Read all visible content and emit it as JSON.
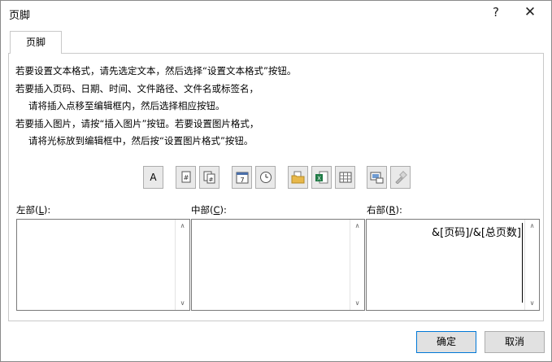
{
  "window": {
    "title": "页脚",
    "help": "?",
    "close": "✕"
  },
  "tab": {
    "label": "页脚"
  },
  "instructions": [
    "若要设置文本格式，请先选定文本，然后选择“设置文本格式”按钮。",
    "若要插入页码、日期、时间、文件路径、文件名或标签名，",
    "请将插入点移至编辑框内，然后选择相应按钮。",
    "若要插入图片，请按“插入图片”按钮。若要设置图片格式，",
    "请将光标放到编辑框中，然后按“设置图片格式”按钮。"
  ],
  "toolbar": {
    "format_text": "A",
    "page_number": "#",
    "total_pages": "#",
    "date": "7",
    "time": "◷"
  },
  "sections": {
    "left": {
      "label_pre": "左部(",
      "key": "L",
      "label_post": "):",
      "value": ""
    },
    "center": {
      "label_pre": "中部(",
      "key": "C",
      "label_post": "):",
      "value": ""
    },
    "right": {
      "label_pre": "右部(",
      "key": "R",
      "label_post": "):",
      "value": "&[页码]/&[总页数]"
    }
  },
  "buttons": {
    "ok": "确定",
    "cancel": "取消"
  }
}
